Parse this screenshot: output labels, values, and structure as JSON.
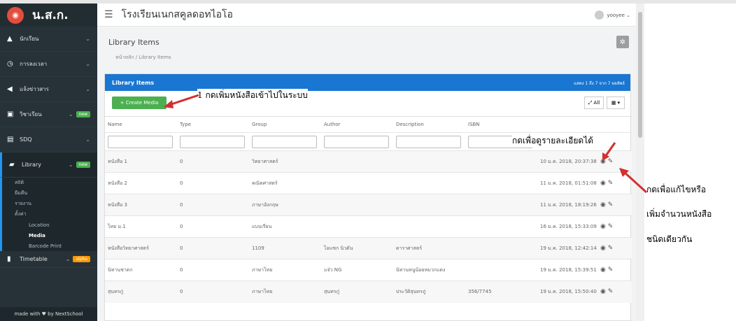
{
  "sidebar": {
    "logo_text": "น.ส.ก.",
    "items": [
      {
        "icon": "graduation-icon",
        "label": "นักเรียน"
      },
      {
        "icon": "clock-icon",
        "label": "การลงเวลา"
      },
      {
        "icon": "megaphone-icon",
        "label": "แจ้งข่าวสาร"
      },
      {
        "icon": "calendar-icon",
        "label": "วิชาเรียน",
        "badge": "new"
      },
      {
        "icon": "box-icon",
        "label": "SDQ"
      },
      {
        "icon": "book-icon",
        "label": "Library",
        "badge": "new"
      }
    ],
    "sub_items": [
      "สถิติ",
      "ยืมคืน",
      "รายงาน",
      "ตั้งค่า"
    ],
    "deep_items": [
      "Location",
      "Media",
      "Barcode Print"
    ],
    "timetable": {
      "label": "Timetable",
      "badge": "alpha"
    },
    "footer": "made with ♥ by NextSchool"
  },
  "header": {
    "school": "โรงเรียนเนกสคูลดอทไอโอ",
    "user": "yooyee ⌄"
  },
  "page": {
    "title": "Library Items",
    "breadcrumb": "หน้าหลัก  /  Library Items"
  },
  "panel": {
    "title": "Library Items",
    "count": "แสดง 1 ถึง 7 จาก 7 ผลลัพธ์",
    "create_label": "+ Create Media",
    "all_label": "⤢ All",
    "export_label": "▦ ▾"
  },
  "table": {
    "headers": [
      "Name",
      "Type",
      "Group",
      "Author",
      "Description",
      "ISBN",
      "",
      ""
    ],
    "rows": [
      [
        "หนังสือ 1",
        "0",
        "วิทยาศาสตร์",
        "",
        "",
        "",
        "10 ม.ค. 2018, 20:37:38"
      ],
      [
        "หนังสือ 2",
        "0",
        "คณิตศาสตร์",
        "",
        "",
        "",
        "11 ม.ค. 2018, 01:51:08"
      ],
      [
        "หนังสือ 3",
        "0",
        "ภาษาอังกฤษ",
        "",
        "",
        "",
        "11 ม.ค. 2018, 18:19:26"
      ],
      [
        "ไทย ม.1",
        "0",
        "แบบเรียน",
        "",
        "",
        "",
        "16 ม.ค. 2018, 15:33:09"
      ],
      [
        "หนังสือวิทยาศาสตร์",
        "0",
        "1109",
        "ไอแซก นิวตัน",
        "ดาราศาสตร์",
        "",
        "19 ม.ค. 2018, 12:42:14"
      ],
      [
        "นิทานชาดก",
        "0",
        "ภาษาไทย",
        "แจ๋ว NG",
        "นิทานหนูน้อยหมวกแดง",
        "",
        "19 ม.ค. 2018, 15:39:51"
      ],
      [
        "สุนทรภู่",
        "0",
        "ภาษาไทย",
        "สุนทรภู่",
        "ประวัติสุนทรภู่",
        "356/7745",
        "19 ม.ค. 2018, 15:50:40"
      ]
    ]
  },
  "annotations": {
    "a1": "1 กดเพิ่มหนังสือเข้าไปในระบบ",
    "a2": "กดเพื่อดูรายละเอียดได้",
    "a3_l1": "กดเพื่อแก้ไขหรือ",
    "a3_l2": "เพิ่มจำนวนหนังสือ",
    "a3_l3": "ชนิดเดียวกัน"
  },
  "colors": {
    "accent": "#1976d2",
    "sidebar": "#263238",
    "create": "#4caf50",
    "arrow": "#d32f2f"
  }
}
